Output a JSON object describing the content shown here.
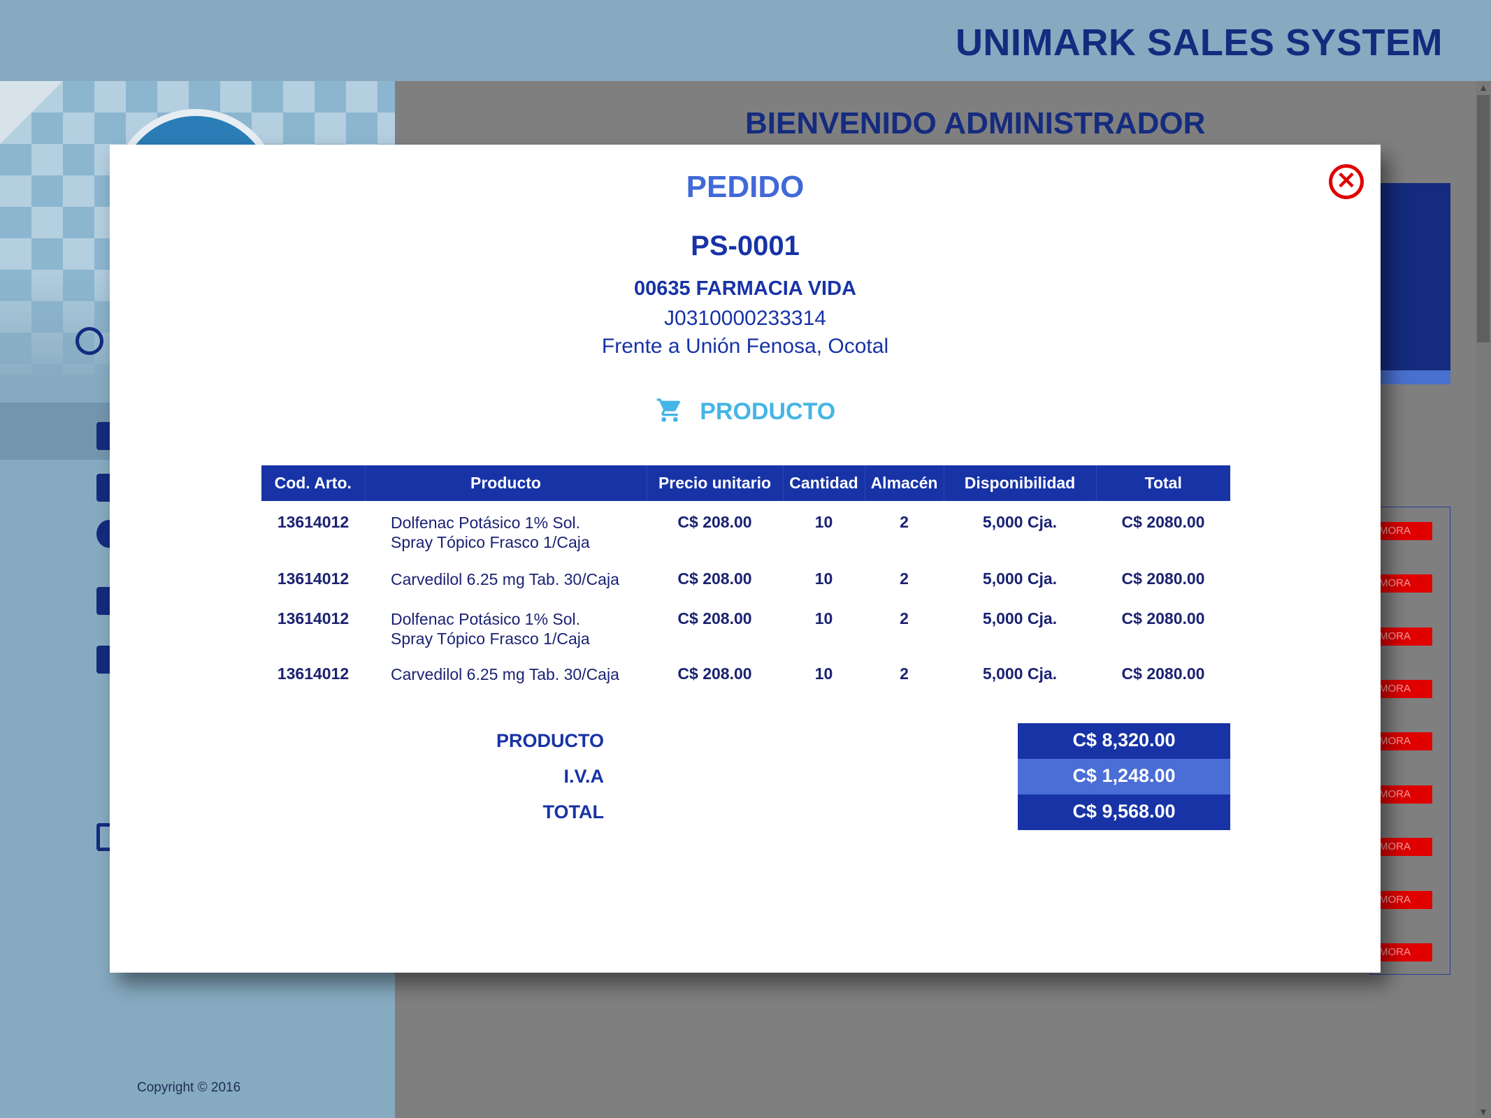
{
  "app": {
    "title": "UNIMARK SALES SYSTEM",
    "welcome": "BIENVENIDO ADMINISTRADOR",
    "copyright": "Copyright © 2016"
  },
  "background": {
    "status_badge": "MORA"
  },
  "modal": {
    "title": "PEDIDO",
    "order_number": "PS-0001",
    "customer": {
      "name": "00635 FARMACIA VIDA",
      "ruc": "J0310000233314",
      "address": "Frente a Unión Fenosa, Ocotal"
    },
    "section_label": "PRODUCTO",
    "close_icon": "close-circle-icon",
    "table": {
      "headers": [
        "Cod. Arto.",
        "Producto",
        "Precio unitario",
        "Cantidad",
        "Almacén",
        "Disponibilidad",
        "Total"
      ],
      "rows": [
        {
          "code": "13614012",
          "product_line1": "Dolfenac Potásico 1% Sol.",
          "product_line2": "Spray Tópico Frasco 1/Caja",
          "price": "C$ 208.00",
          "qty": "10",
          "warehouse": "2",
          "availability": "5,000 Cja.",
          "total": "C$ 2080.00"
        },
        {
          "code": "13614012",
          "product_line1": "Carvedilol 6.25 mg Tab. 30/Caja",
          "product_line2": "",
          "price": "C$ 208.00",
          "qty": "10",
          "warehouse": "2",
          "availability": "5,000 Cja.",
          "total": "C$ 2080.00"
        },
        {
          "code": "13614012",
          "product_line1": "Dolfenac Potásico 1% Sol.",
          "product_line2": "Spray Tópico Frasco 1/Caja",
          "price": "C$ 208.00",
          "qty": "10",
          "warehouse": "2",
          "availability": "5,000 Cja.",
          "total": "C$ 2080.00"
        },
        {
          "code": "13614012",
          "product_line1": "Carvedilol 6.25 mg Tab. 30/Caja",
          "product_line2": "",
          "price": "C$ 208.00",
          "qty": "10",
          "warehouse": "2",
          "availability": "5,000 Cja.",
          "total": "C$ 2080.00"
        }
      ]
    },
    "totals": {
      "product_label": "PRODUCTO",
      "product_value": "C$ 8,320.00",
      "tax_label": "I.V.A",
      "tax_value": "C$ 1,248.00",
      "total_label": "TOTAL",
      "total_value": "C$ 9,568.00"
    }
  },
  "colors": {
    "primary": "#1733a6",
    "accent": "#4169d8",
    "cart": "#45b5e6",
    "danger": "#e00000"
  }
}
